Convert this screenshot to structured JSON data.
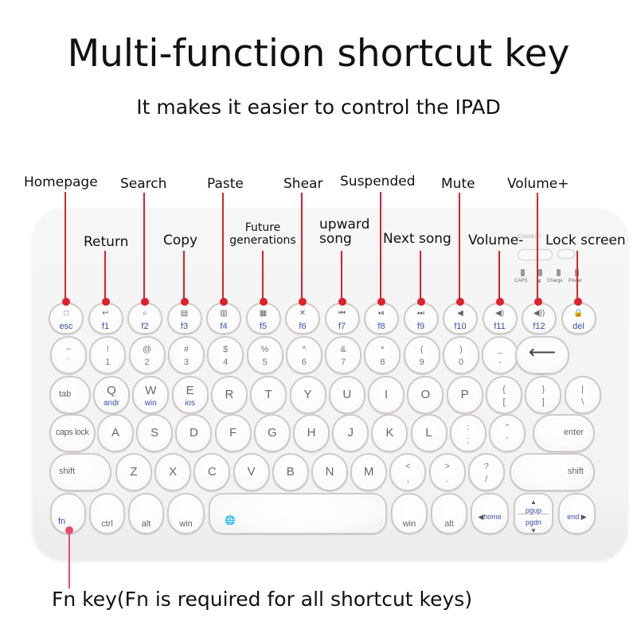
{
  "header": {
    "title": "Multi-function shortcut key",
    "subtitle": "It makes it easier to control the IPAD"
  },
  "annotations": {
    "homepage": "Homepage",
    "return": "Return",
    "search": "Search",
    "copy": "Copy",
    "paste": "Paste",
    "future_line1": "Future",
    "future_line2": "generations",
    "shear": "Shear",
    "upward_line1": "upward",
    "upward_line2": "song",
    "suspended": "Suspended",
    "next_song": "Next song",
    "mute": "Mute",
    "volume_down": "Volume-",
    "volume_up": "Volume+",
    "lock_screen": "Lock screen"
  },
  "footer_note": "Fn  key(Fn is required for all shortcut keys)",
  "status_panel": {
    "connect_label": "CONNECT",
    "leds": [
      "CAPS",
      "BT",
      "Charge",
      "Power"
    ]
  },
  "accent_color": "#e0202a",
  "fn_label_color": "#3a4fb0",
  "keyboard": {
    "fn_row": [
      {
        "label": "esc",
        "icon": "□"
      },
      {
        "label": "f1",
        "icon": "↩"
      },
      {
        "label": "f2",
        "icon": "⌕"
      },
      {
        "label": "f3",
        "icon": "▤"
      },
      {
        "label": "f4",
        "icon": "▥"
      },
      {
        "label": "f5",
        "icon": "▦"
      },
      {
        "label": "f6",
        "icon": "✕"
      },
      {
        "label": "f7",
        "icon": "⏮"
      },
      {
        "label": "f8",
        "icon": "⏯"
      },
      {
        "label": "f9",
        "icon": "⏭"
      },
      {
        "label": "f10",
        "icon": "◀"
      },
      {
        "label": "f11",
        "icon": "◀)"
      },
      {
        "label": "f12",
        "icon": "◀))"
      },
      {
        "label": "del",
        "icon": "🔒"
      }
    ],
    "number_row": [
      {
        "top": "~",
        "bot": "`"
      },
      {
        "top": "!",
        "bot": "1"
      },
      {
        "top": "@",
        "bot": "2"
      },
      {
        "top": "#",
        "bot": "3"
      },
      {
        "top": "$",
        "bot": "4"
      },
      {
        "top": "%",
        "bot": "5"
      },
      {
        "top": "^",
        "bot": "6"
      },
      {
        "top": "&",
        "bot": "7"
      },
      {
        "top": "*",
        "bot": "8"
      },
      {
        "top": "(",
        "bot": "9"
      },
      {
        "top": ")",
        "bot": "0"
      },
      {
        "top": "_",
        "bot": "-"
      },
      {
        "top": "+",
        "bot": "="
      },
      {
        "label": "⟵"
      }
    ],
    "qwerty_row": [
      {
        "label": "tab"
      },
      {
        "main": "Q",
        "sub": "andr"
      },
      {
        "main": "W",
        "sub": "win"
      },
      {
        "main": "E",
        "sub": "ios"
      },
      {
        "main": "R"
      },
      {
        "main": "T"
      },
      {
        "main": "Y"
      },
      {
        "main": "U"
      },
      {
        "main": "I"
      },
      {
        "main": "O"
      },
      {
        "main": "P"
      },
      {
        "top": "{",
        "bot": "["
      },
      {
        "top": "}",
        "bot": "]"
      },
      {
        "top": "|",
        "bot": "\\"
      }
    ],
    "home_row": [
      {
        "label": "caps lock"
      },
      {
        "main": "A"
      },
      {
        "main": "S"
      },
      {
        "main": "D"
      },
      {
        "main": "F"
      },
      {
        "main": "G"
      },
      {
        "main": "H"
      },
      {
        "main": "J"
      },
      {
        "main": "K"
      },
      {
        "main": "L"
      },
      {
        "top": ":",
        "bot": ";"
      },
      {
        "top": "\"",
        "bot": "'"
      },
      {
        "label": "enter"
      }
    ],
    "shift_row": [
      {
        "label": "shift"
      },
      {
        "main": "Z"
      },
      {
        "main": "X"
      },
      {
        "main": "C"
      },
      {
        "main": "V"
      },
      {
        "main": "B"
      },
      {
        "main": "N"
      },
      {
        "main": "M"
      },
      {
        "top": "<",
        "bot": ","
      },
      {
        "top": ">",
        "bot": "."
      },
      {
        "top": "?",
        "bot": "/"
      },
      {
        "label": "shift"
      }
    ],
    "bottom_row": {
      "fn": "fn",
      "ctrl": "ctrl",
      "alt_left": "alt",
      "win_left": "win",
      "space_icon": "🌐",
      "win_right": "win",
      "alt_right": "alt",
      "home": "home",
      "pgup": "pgup",
      "pgdn": "pgdn",
      "end": "end"
    }
  }
}
